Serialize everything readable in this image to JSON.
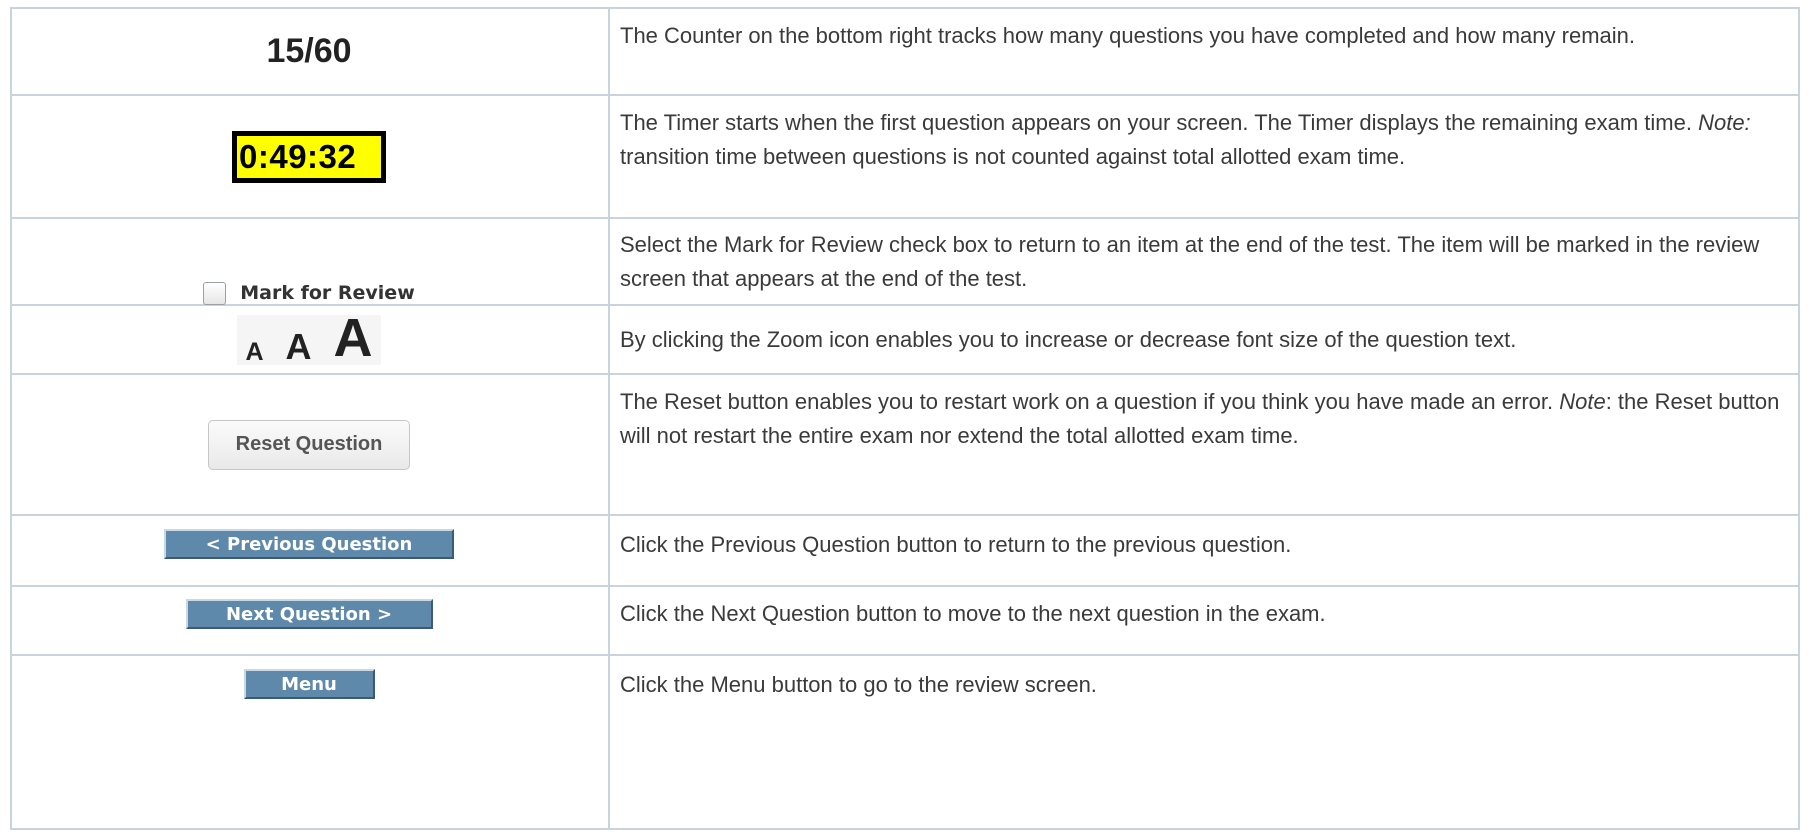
{
  "rows": [
    {
      "demo": {
        "counter": "15/60"
      },
      "description": "The Counter on the bottom right tracks how many questions you have completed and how many remain."
    },
    {
      "demo": {
        "timer": "0:49:32"
      },
      "description_parts": [
        "The Timer starts when the first question appears on your screen. The Timer displays the remaining exam time. ",
        "Note:",
        " transition time between questions is not counted against total allotted exam time."
      ]
    },
    {
      "demo": {
        "checkbox_label": "Mark for Review",
        "checked": false
      },
      "description": "Select the Mark for Review check box to return to an item at the end of the test. The item will be marked in the review screen that appears at the end of the test."
    },
    {
      "demo": {
        "zoom_small": "A",
        "zoom_medium": "A",
        "zoom_large": "A"
      },
      "description": "By clicking the Zoom icon enables you to increase or decrease font size of the question text."
    },
    {
      "demo": {
        "button": "Reset Question"
      },
      "description_parts": [
        "The Reset button enables you to restart work on a question if you think you have made an error. ",
        "Note",
        ": the Reset button will not restart the entire exam nor extend the total allotted exam time."
      ]
    },
    {
      "demo": {
        "button": "< Previous Question"
      },
      "description": "Click the Previous Question button to return to the previous question."
    },
    {
      "demo": {
        "button": "Next Question >"
      },
      "description": "Click the Next Question button to move to the next question in the exam."
    },
    {
      "demo": {
        "button": "Menu"
      },
      "description": "Click the Menu button to go to the review screen."
    }
  ],
  "colors": {
    "grid_line": "#c9d3dd",
    "timer_background": "#ffff00",
    "nav_button": "#5f89ab",
    "text": "#3a3a3a"
  }
}
